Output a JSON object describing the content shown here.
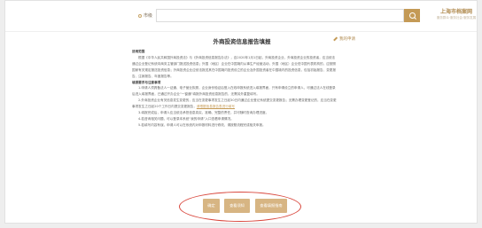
{
  "header": {
    "city": "市级",
    "search_placeholder": "",
    "brand_name": "上海市档案网",
    "brand_sub": "服务群众·服务社会·服务发展"
  },
  "main": {
    "title": "外商投资信息报告填报",
    "aside_link": "我的申请",
    "paragraphs": [
      {
        "text": "适用范围",
        "cls": "h"
      },
      {
        "text": "根据《中华人民共和国外商投资法》与《外商投资信息报告办法》，自2020年1月1日起，外商投资企业、外商投资企业的投资者，应当依法通过企业登记系统向商务主管部门报送投资信息；外国（地区）企业在中国境内从事生产经营活动，外国（地区）企业驻中国代表机构的，应按照国家有关规定报送投资信息；外商投资企业应依法报送其在中国境内投资设立的企业及外国投资者在中国境内的投资信息，包括初始报告、变更报告、注销报告、年度报告等。",
        "cls": "ind"
      },
      {
        "text": "填报要求与注意事项",
        "cls": "h"
      },
      {
        "text": "1.申请人须具备法人一证通、电子营业执照，企业身份验证后登入在线申报系统进入填报界面，只有申请设立的申请人，可通过法人在线登录后进入填报界面，已通过开办企业“一窗通”填报外商投资信息报告的，无需另外重复填写。",
        "cls": "ind"
      },
      {
        "text": "2.外商投资企业有关信息发生变更的，应当在变更事项发生之日起30日内通过企业登记系统提交变更报告；无需办理变更登记的，应当在变更事项发生之日起20个工作日内提交变更报告，",
        "cls": "ind",
        "link": "请根据信息报告表进行填写"
      },
      {
        "text": "3.填报完成后，申请人应当依法承担信息真实、准确、完整的责任，并可随时查询办理进度。",
        "cls": "ind"
      },
      {
        "text": "4.若咨询相关问题，可以登录本系统“我的申请”入口查看申请情况。",
        "cls": "ind"
      },
      {
        "text": "5.若填写内容有误，申请人可以在系统内对申报材料进行修改，请按照流程完成相关申报。",
        "cls": "ind"
      }
    ]
  },
  "actions": {
    "btn1": "确定",
    "btn2": "查看须知",
    "btn3": "查看填报指南"
  }
}
